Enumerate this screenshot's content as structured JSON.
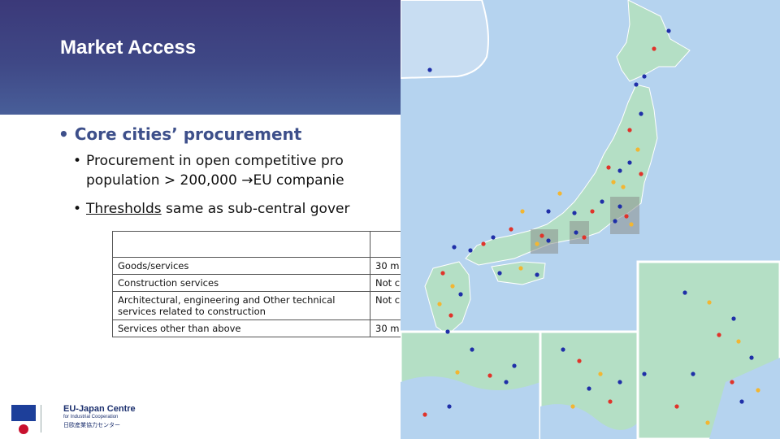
{
  "slide": {
    "title": "Market Access"
  },
  "bullets": {
    "core": "Core cities’ procurement",
    "sub1_line1": "Procurement in open competitive pro",
    "sub1_line2a": "population > 200,000 ",
    "sub1_arrow": "→",
    "sub1_line2b": "EU companie",
    "sub2_underlined": "Thresholds",
    "sub2_rest": " same as sub-central gover"
  },
  "thresholds_table": {
    "header": [
      "",
      ""
    ],
    "rows": [
      {
        "category": "Goods/services",
        "value": "30 m"
      },
      {
        "category": "Construction services",
        "value": "Not c"
      },
      {
        "category": "Architectural, engineering and Other technical services related to construction",
        "value": "Not c"
      },
      {
        "category": "Services other than above",
        "value": "30 m"
      }
    ]
  },
  "logo": {
    "name": "EU-Japan Centre",
    "subtitle": "for Industrial Cooperation",
    "japanese": "日欧産業協力センター"
  },
  "map": {
    "colors": {
      "sea": "#b5d3ef",
      "land": "#b4dfc5",
      "border": "#ffffff",
      "highlight": "#8a8f8c",
      "blue_dot": "#1f2fa8",
      "red_dot": "#e0332a",
      "yellow_dot": "#f2b632"
    }
  }
}
